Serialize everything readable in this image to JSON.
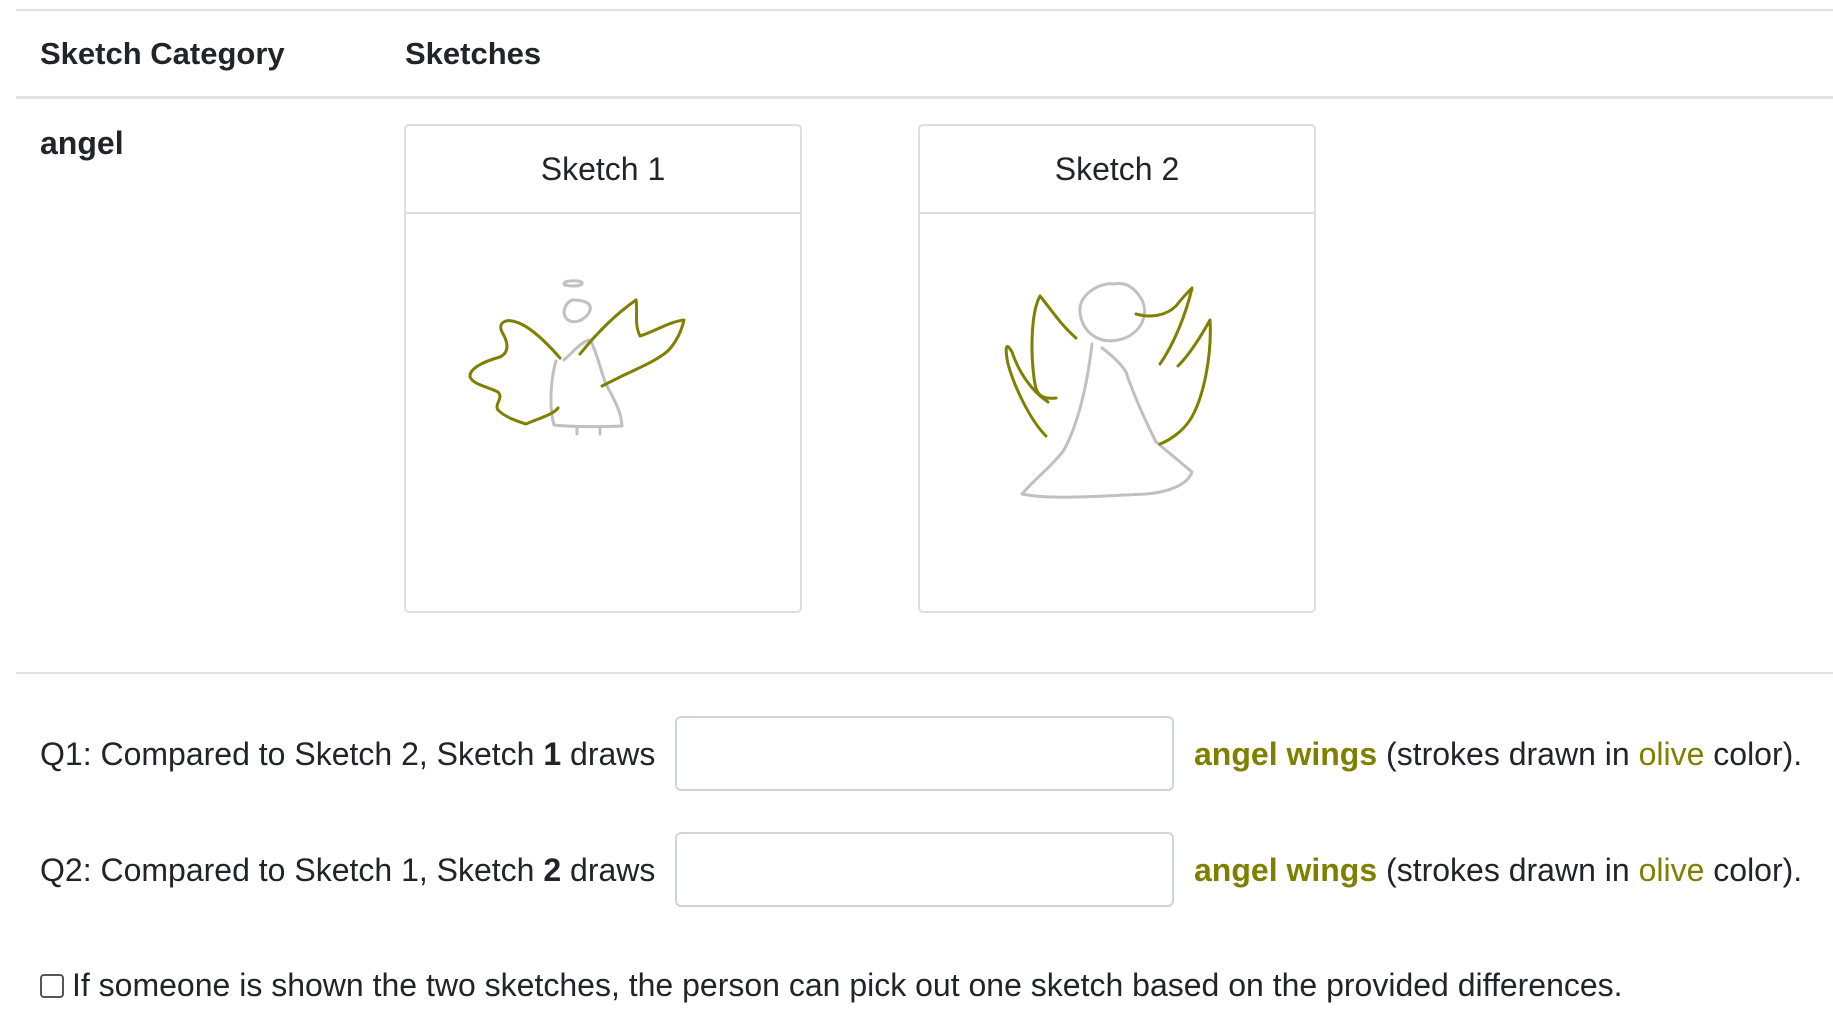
{
  "table": {
    "header_category": "Sketch Category",
    "header_sketches": "Sketches",
    "category": "angel"
  },
  "sketches": [
    {
      "title": "Sketch 1"
    },
    {
      "title": "Sketch 2"
    }
  ],
  "colors": {
    "highlight": "#808000",
    "base_stroke": "#c0c0c0"
  },
  "questions": [
    {
      "prefix": "Q1: Compared to Sketch 2, Sketch ",
      "number": "1",
      "verb": " draws",
      "answer_value": "",
      "part_name": "angel wings",
      "note_open": " (strokes drawn in ",
      "color_word": "olive",
      "note_close": " color)."
    },
    {
      "prefix": "Q2: Compared to Sketch 1, Sketch ",
      "number": "2",
      "verb": " draws",
      "answer_value": "",
      "part_name": "angel wings",
      "note_open": " (strokes drawn in ",
      "color_word": "olive",
      "note_close": " color)."
    }
  ],
  "confirmation": {
    "label": "If someone is shown the two sketches, the person can pick out one sketch based on the provided differences.",
    "checked": false
  }
}
